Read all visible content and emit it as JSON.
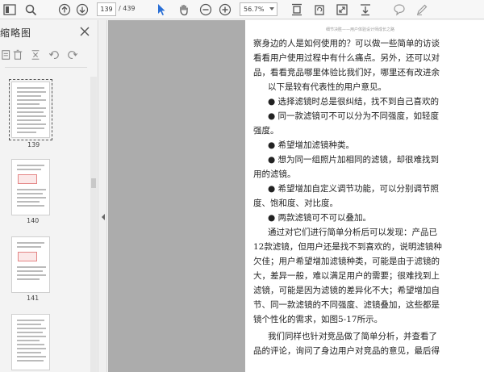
{
  "toolbar": {
    "current_page": "139",
    "total_pages": "/ 439",
    "zoom": "56.7%"
  },
  "sidebar": {
    "title": "缩略图",
    "thumbnails": [
      {
        "label": "139",
        "selected": true
      },
      {
        "label": "140",
        "selected": false
      },
      {
        "label": "141",
        "selected": false
      },
      {
        "label": "",
        "selected": false
      }
    ]
  },
  "page": {
    "running_head": "细节决胜——用户体验设计师成长之路",
    "lines": [
      "察身边的人是如何使用的？可以做一些简单的访谈",
      "看看用户使用过程中有什么痛点。另外，还可以对",
      "品，看看竞品哪里体验比我们好，哪里还有改进余",
      "以下是较有代表性的用户意见。",
      "● 选择滤镜时总是很纠结，找不到自己喜欢的",
      "● 同一款滤镜可不可以分为不同强度，如轻度",
      "强度。",
      "● 希望增加滤镜种类。",
      "● 想为同一组照片加相同的滤镜，却很难找到",
      "用的滤镜。",
      "● 希望增加自定义调节功能，可以分别调节照",
      "度、饱和度、对比度。",
      "● 两款滤镜可不可以叠加。",
      "通过对它们进行简单分析后可以发现：产品已",
      "12款滤镜，但用户还是找不到喜欢的，说明滤镜种",
      "欠佳；用户希望增加滤镜种类，可能是由于滤镜的",
      "大，差异一般，难以满足用户的需要；很难找到上",
      "滤镜，可能是因为滤镜的差异化不大；希望增加自",
      "节、同一款滤镜的不同强度、滤镜叠加，这些都是",
      "镜个性化的需求，如图5-17所示。",
      "我们同样也针对竞品做了简单分析，并查看了",
      "品的评论，询问了身边用户对竞品的意见，最后得"
    ]
  }
}
